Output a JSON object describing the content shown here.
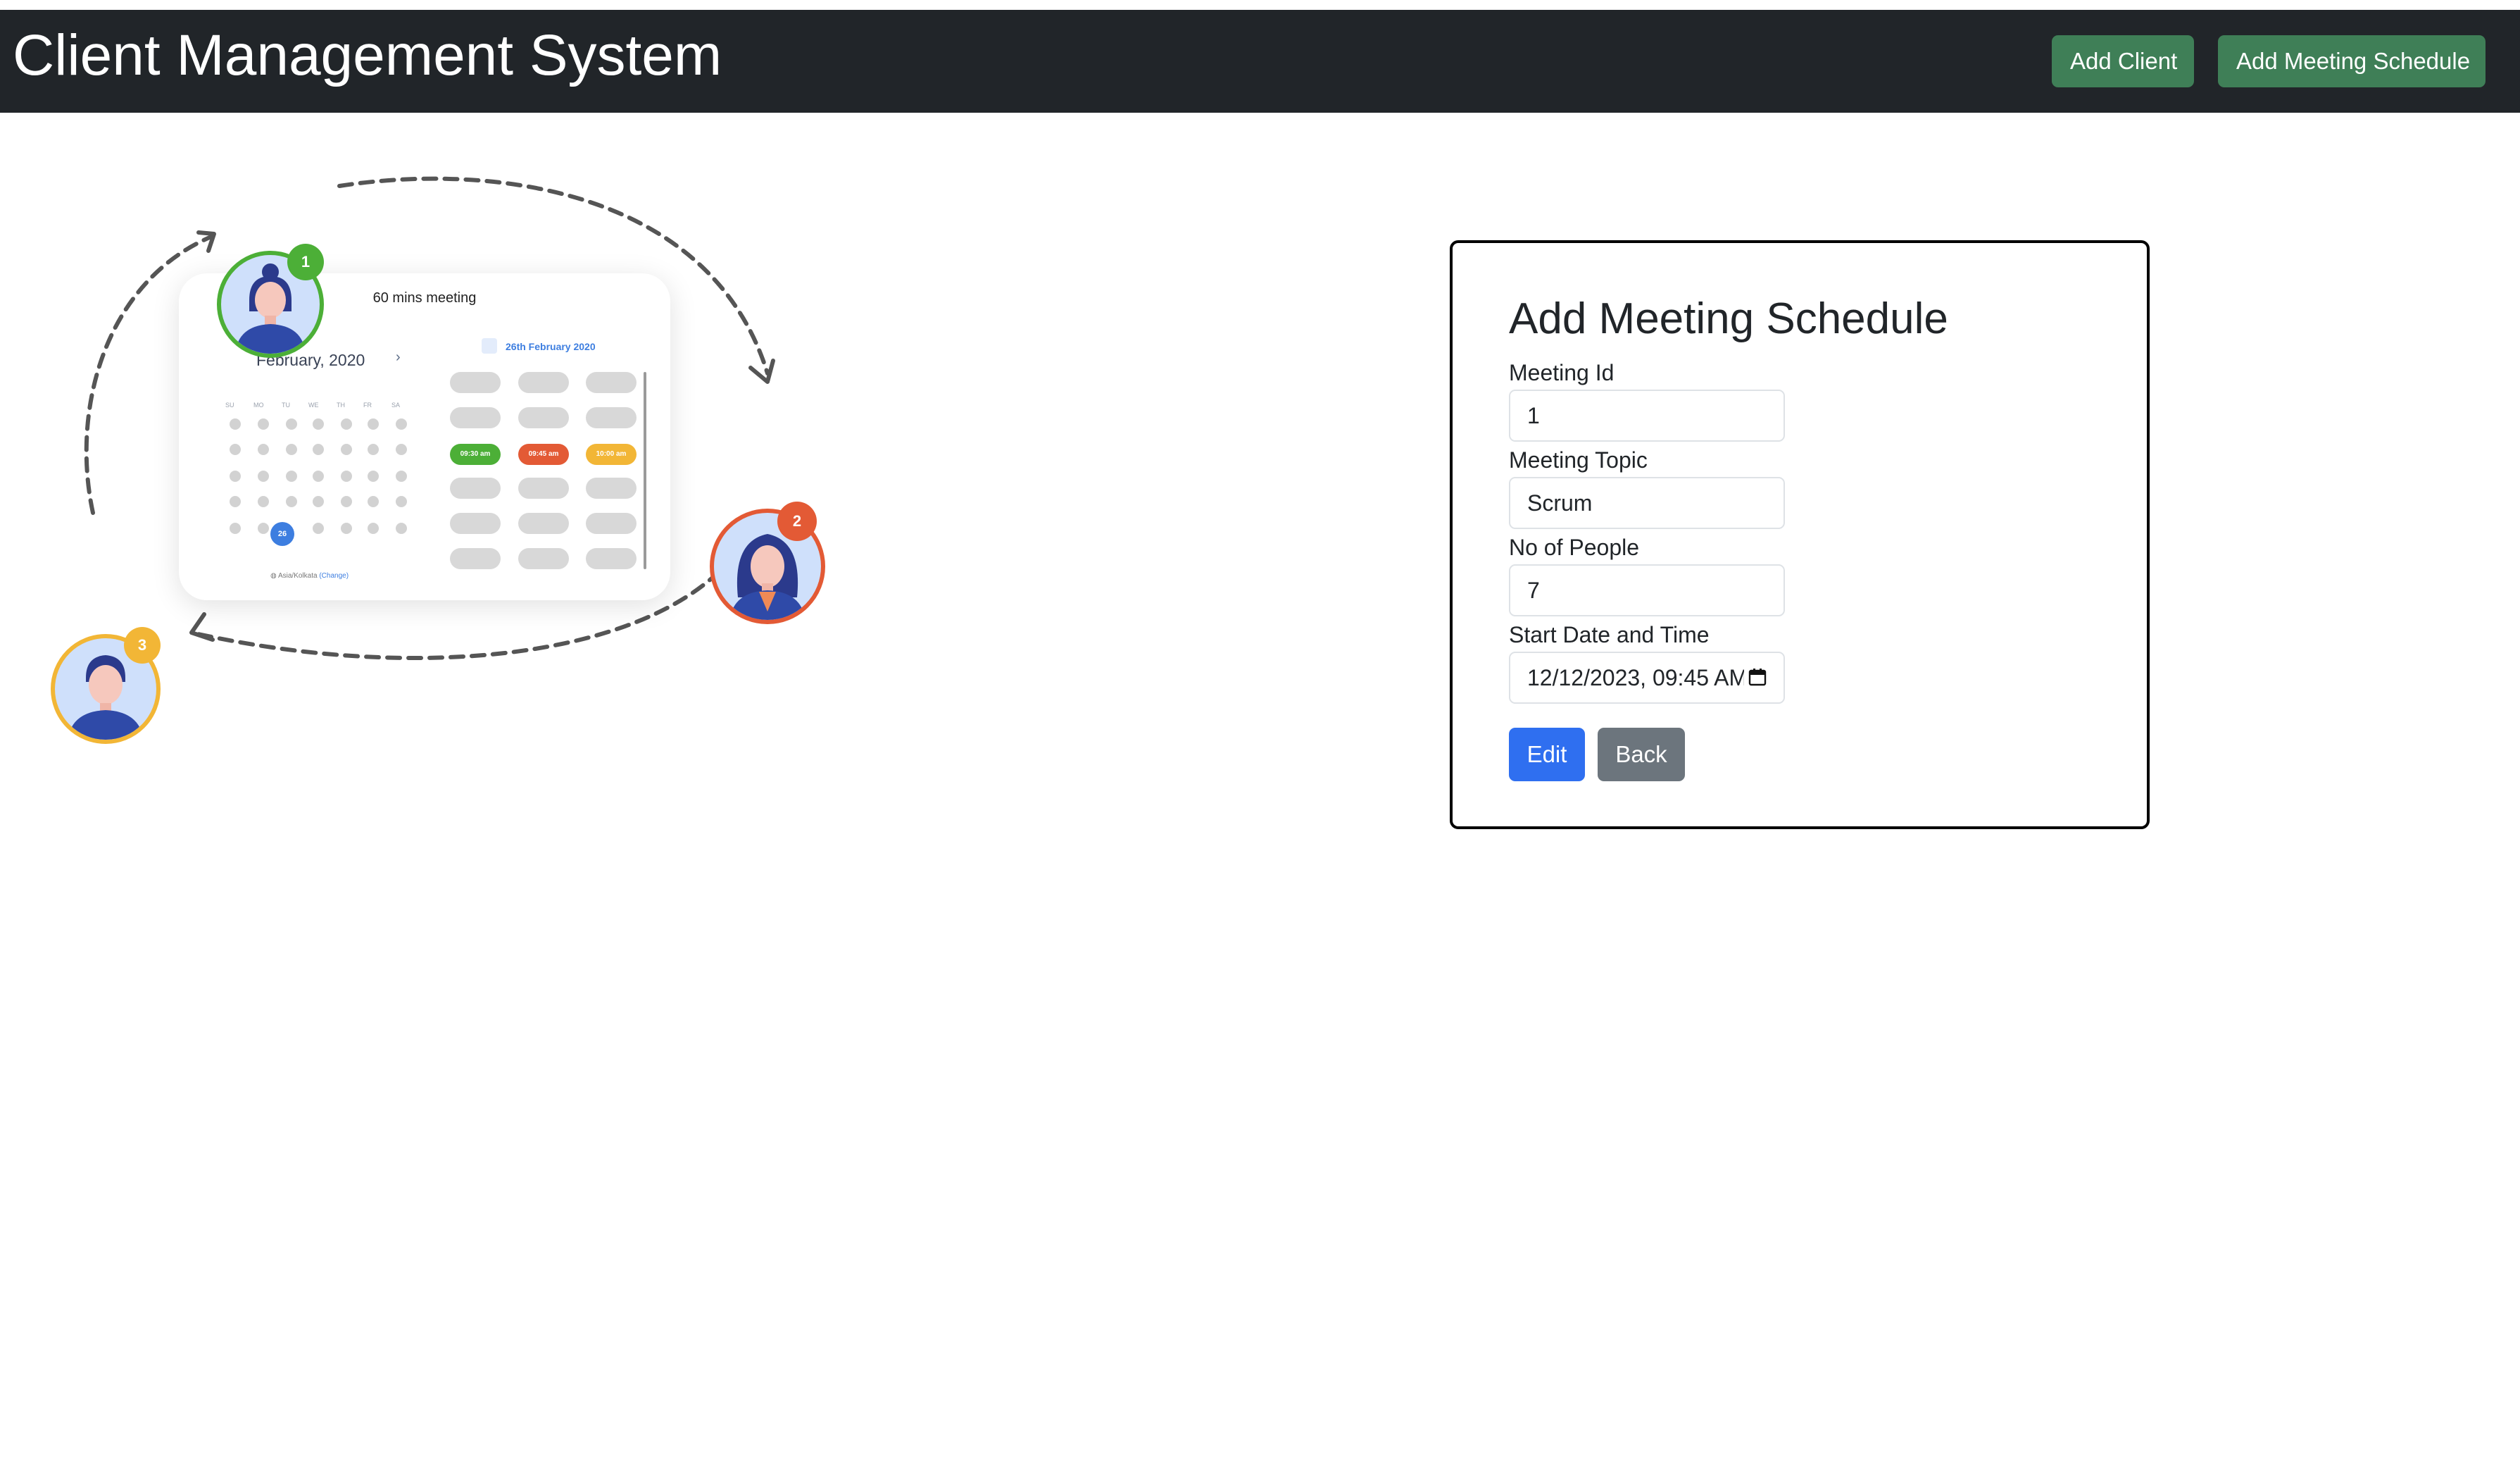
{
  "navbar": {
    "brand": "Client Management System",
    "add_client_label": "Add Client",
    "add_meeting_label": "Add Meeting Schedule"
  },
  "illustration": {
    "card_title": "60 mins meeting",
    "month": "February, 2020",
    "selected_date": "26th February 2020",
    "day_headers": [
      "SU",
      "MO",
      "TU",
      "WE",
      "TH",
      "FR",
      "SA"
    ],
    "selected_day": "26",
    "slots": [
      "09:30 am",
      "09:45 am",
      "10:00 am"
    ],
    "timezone": "Asia/Kolkata",
    "timezone_change": "(Change)",
    "badges": [
      "1",
      "2",
      "3"
    ],
    "colors": {
      "badge_1": "#4caf37",
      "badge_2": "#e35a35",
      "badge_3": "#f2b636",
      "selected": "#3d7ee0"
    }
  },
  "form": {
    "title": "Add Meeting Schedule",
    "meeting_id_label": "Meeting Id",
    "meeting_id_value": "1",
    "topic_label": "Meeting Topic",
    "topic_value": "Scrum",
    "people_label": "No of People",
    "people_value": "7",
    "start_label": "Start Date and Time",
    "start_value": "12/12/2023, 09:45 AM",
    "edit_label": "Edit",
    "back_label": "Back"
  },
  "colors": {
    "navbar_bg": "#212529",
    "nav_button": "#3f7f57",
    "edit_button": "#2f6ff0",
    "back_button": "#6c757d"
  }
}
